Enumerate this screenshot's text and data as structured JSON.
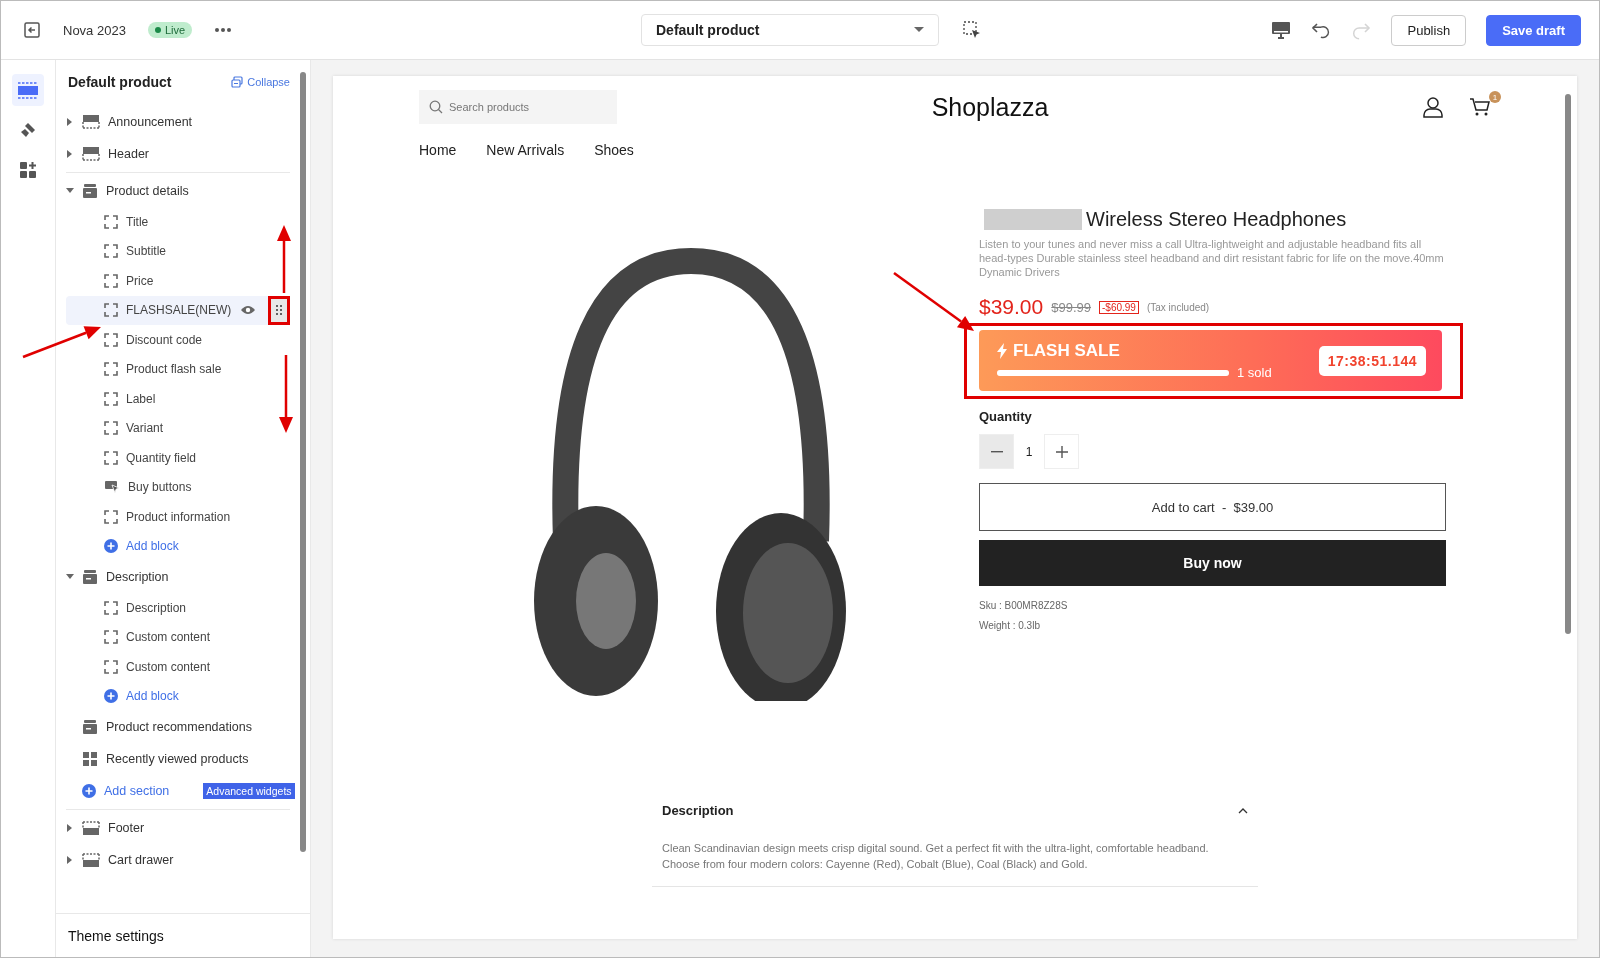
{
  "topbar": {
    "title": "Nova 2023",
    "status": "Live",
    "template": "Default product",
    "redo_disabled": true,
    "buttons": [
      {
        "label": "Publish",
        "kind": "secondary"
      },
      {
        "label": "Save draft",
        "kind": "primary"
      }
    ]
  },
  "rail": [
    {
      "selected": true
    },
    {
      "selected": false
    },
    {
      "selected": false
    }
  ],
  "sidebar": {
    "title": "Default product",
    "collapse": "Collapse",
    "groups": [
      {
        "sections": [
          {
            "label": "Announcement",
            "kind": "header",
            "expanded": false
          },
          {
            "label": "Header",
            "kind": "header",
            "expanded": false
          }
        ]
      },
      {
        "sections": [
          {
            "label": "Product details",
            "kind": "section",
            "expanded": true,
            "children": [
              {
                "label": "Title",
                "kind": "block",
                "selected": false
              },
              {
                "label": "Subtitle",
                "kind": "block",
                "selected": false
              },
              {
                "label": "Price",
                "kind": "block",
                "selected": false
              },
              {
                "label": "FLASHSALE(NEW)",
                "kind": "block",
                "selected": true
              },
              {
                "label": "Discount code",
                "kind": "block",
                "selected": false
              },
              {
                "label": "Product flash sale",
                "kind": "block",
                "selected": false
              },
              {
                "label": "Label",
                "kind": "block",
                "selected": false
              },
              {
                "label": "Variant",
                "kind": "block",
                "selected": false
              },
              {
                "label": "Quantity field",
                "kind": "block",
                "selected": false
              },
              {
                "label": "Buy buttons",
                "kind": "buttons",
                "selected": false
              },
              {
                "label": "Product information",
                "kind": "block",
                "selected": false
              },
              {
                "label": "Add block",
                "kind": "add"
              }
            ]
          },
          {
            "label": "Description",
            "kind": "section",
            "expanded": true,
            "children": [
              {
                "label": "Description",
                "kind": "block",
                "selected": false
              },
              {
                "label": "Custom content",
                "kind": "block",
                "selected": false
              },
              {
                "label": "Custom content",
                "kind": "block",
                "selected": false
              },
              {
                "label": "Add block",
                "kind": "add"
              }
            ]
          },
          {
            "label": "Product recommendations",
            "kind": "section"
          },
          {
            "label": "Recently viewed products",
            "kind": "grid"
          },
          {
            "label": "Add section",
            "kind": "add",
            "badge": "Advanced widgets"
          }
        ]
      },
      {
        "sections": [
          {
            "label": "Footer",
            "kind": "footer",
            "expanded": false
          },
          {
            "label": "Cart drawer",
            "kind": "footer",
            "expanded": false
          }
        ]
      }
    ],
    "footer": "Theme settings"
  },
  "preview": {
    "search_placeholder": "Search products",
    "store_name": "Shoplazza",
    "cart_count": "1",
    "nav": [
      "Home",
      "New Arrivals",
      "Shoes"
    ],
    "product": {
      "title": "Wireless Stereo Headphones",
      "summary": "Listen to your tunes and never miss a call Ultra-lightweight and adjustable headband fits all head-types Durable stainless steel headband and dirt resistant fabric for life on the move.40mm Dynamic Drivers",
      "price": "$39.00",
      "compare_price": "$99.99",
      "discount": "-$60.99",
      "tax_note": "(Tax included)",
      "flash_sale": {
        "title": "FLASH SALE",
        "level": 1,
        "sold": "1 sold",
        "countdown": "17:38:51.144"
      },
      "quantity_label": "Quantity",
      "quantity": "1",
      "add_to_cart": "Add to cart  -  $39.00",
      "buy_now": "Buy now",
      "sku": "Sku : B00MR8Z28S",
      "weight": "Weight : 0.3lb"
    },
    "description": {
      "title": "Description",
      "expanded": true,
      "text": "Clean Scandinavian design meets crisp digital sound. Get a perfect fit with the ultra-light, comfortable headband. Choose from four modern colors: Cayenne (Red), Cobalt (Blue), Coal (Black) and Gold."
    }
  }
}
